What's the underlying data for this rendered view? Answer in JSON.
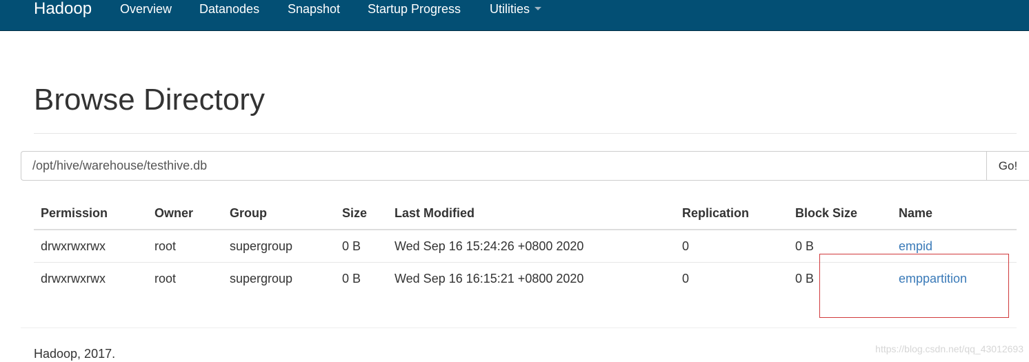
{
  "nav": {
    "brand": "Hadoop",
    "items": [
      {
        "label": "Overview"
      },
      {
        "label": "Datanodes"
      },
      {
        "label": "Snapshot"
      },
      {
        "label": "Startup Progress"
      },
      {
        "label": "Utilities"
      }
    ]
  },
  "page": {
    "title": "Browse Directory"
  },
  "path_bar": {
    "value": "/opt/hive/warehouse/testhive.db",
    "go_label": "Go!"
  },
  "table": {
    "headers": [
      "Permission",
      "Owner",
      "Group",
      "Size",
      "Last Modified",
      "Replication",
      "Block Size",
      "Name"
    ],
    "rows": [
      {
        "permission": "drwxrwxrwx",
        "owner": "root",
        "group": "supergroup",
        "size": "0 B",
        "last_modified": "Wed Sep 16 15:24:26 +0800 2020",
        "replication": "0",
        "block_size": "0 B",
        "name": "empid"
      },
      {
        "permission": "drwxrwxrwx",
        "owner": "root",
        "group": "supergroup",
        "size": "0 B",
        "last_modified": "Wed Sep 16 16:15:21 +0800 2020",
        "replication": "0",
        "block_size": "0 B",
        "name": "emppartition"
      }
    ]
  },
  "footer": {
    "text": "Hadoop, 2017."
  },
  "watermark": "https://blog.csdn.net/qq_43012693",
  "colors": {
    "navbar": "#034f74",
    "link": "#3a7ab8",
    "annotation": "#d0393b"
  },
  "icons": {
    "utilities_dropdown": "caret-down-icon"
  }
}
